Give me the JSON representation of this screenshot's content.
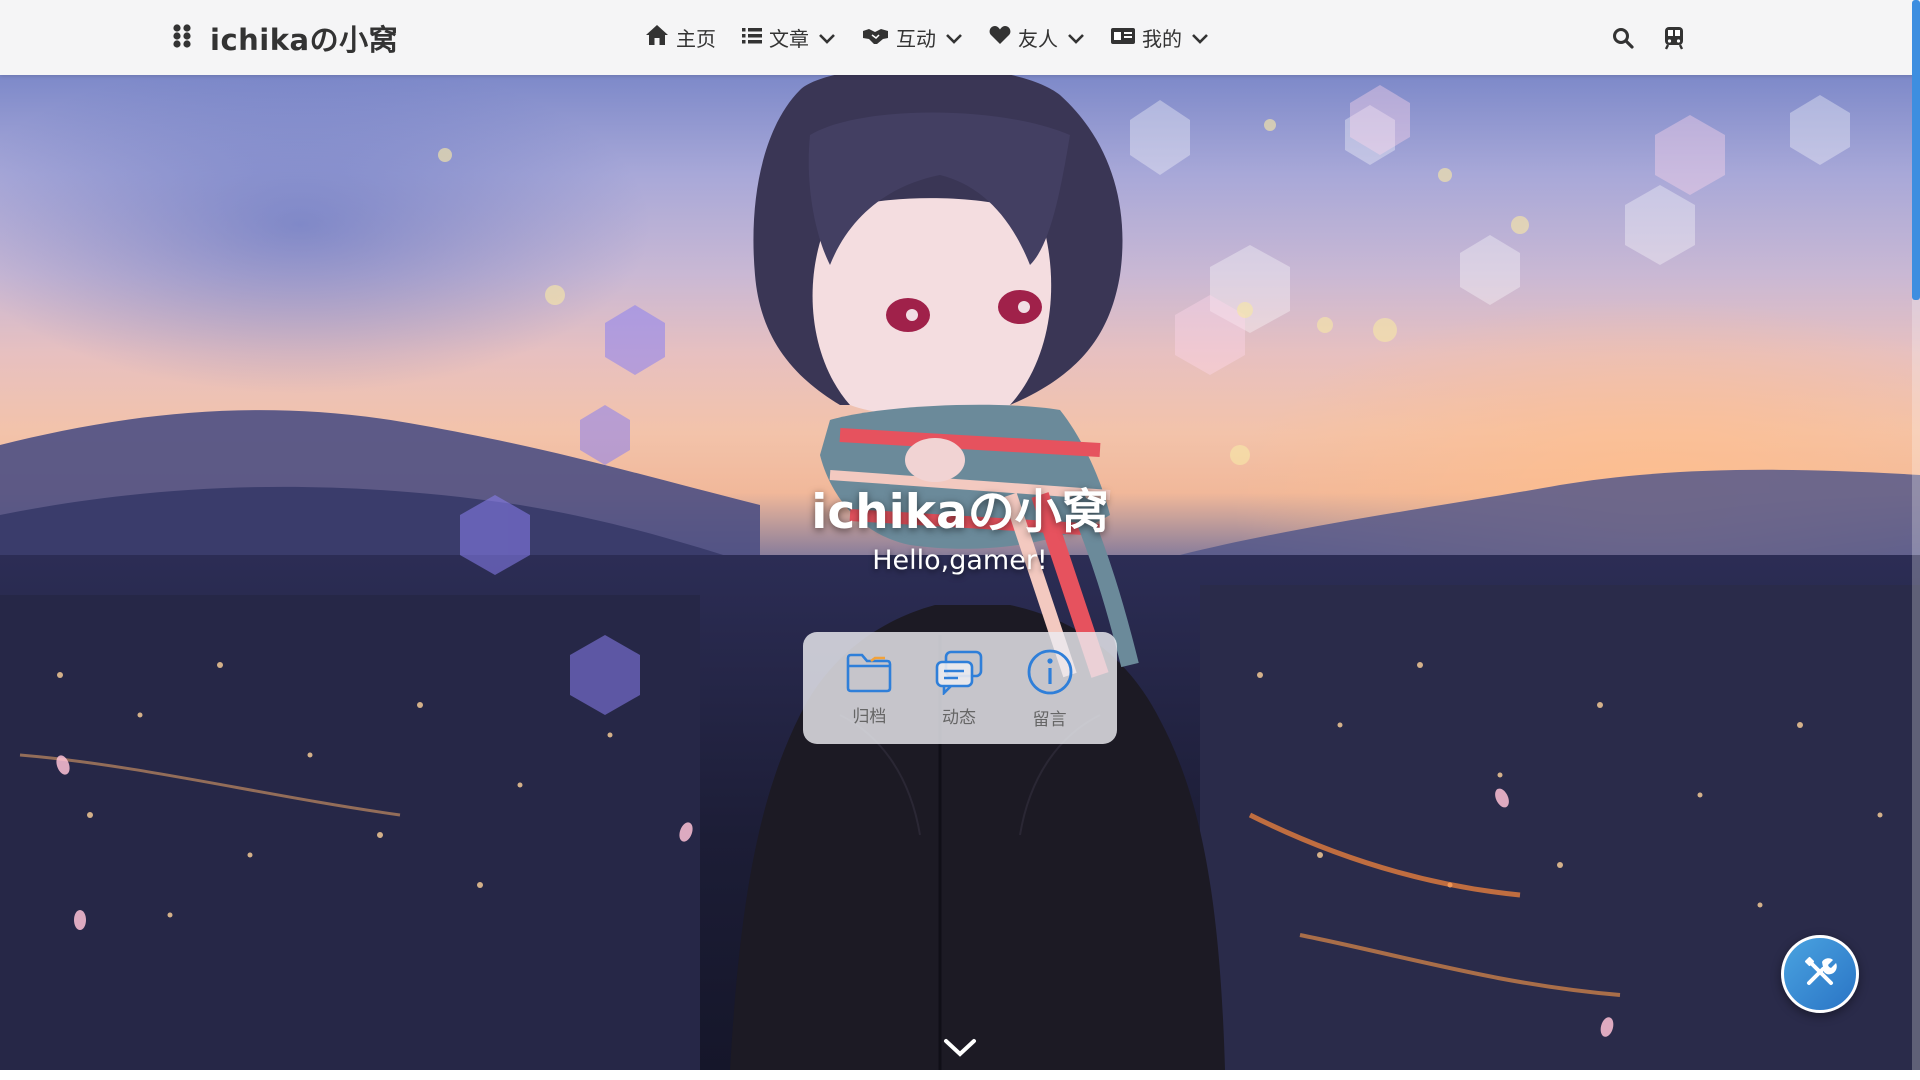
{
  "navbar": {
    "brand_title": "ichikaの小窝",
    "menu": [
      {
        "label": "主页",
        "icon": "home-icon",
        "has_dropdown": false
      },
      {
        "label": "文章",
        "icon": "list-icon",
        "has_dropdown": true
      },
      {
        "label": "互动",
        "icon": "handshake-icon",
        "has_dropdown": true
      },
      {
        "label": "友人",
        "icon": "heart-icon",
        "has_dropdown": true
      },
      {
        "label": "我的",
        "icon": "id-card-icon",
        "has_dropdown": true
      }
    ],
    "actions": [
      "search-icon",
      "train-icon"
    ]
  },
  "hero": {
    "title": "ichikaの小窝",
    "subtitle": "Hello,gamer!",
    "quick_links": [
      {
        "label": "归档",
        "icon": "folder-icon"
      },
      {
        "label": "动态",
        "icon": "chat-icon"
      },
      {
        "label": "留言",
        "icon": "info-icon"
      }
    ]
  },
  "colors": {
    "accent": "#3d8ee0",
    "nav_text": "#333333",
    "quick_icon": "#2f7fd9"
  }
}
